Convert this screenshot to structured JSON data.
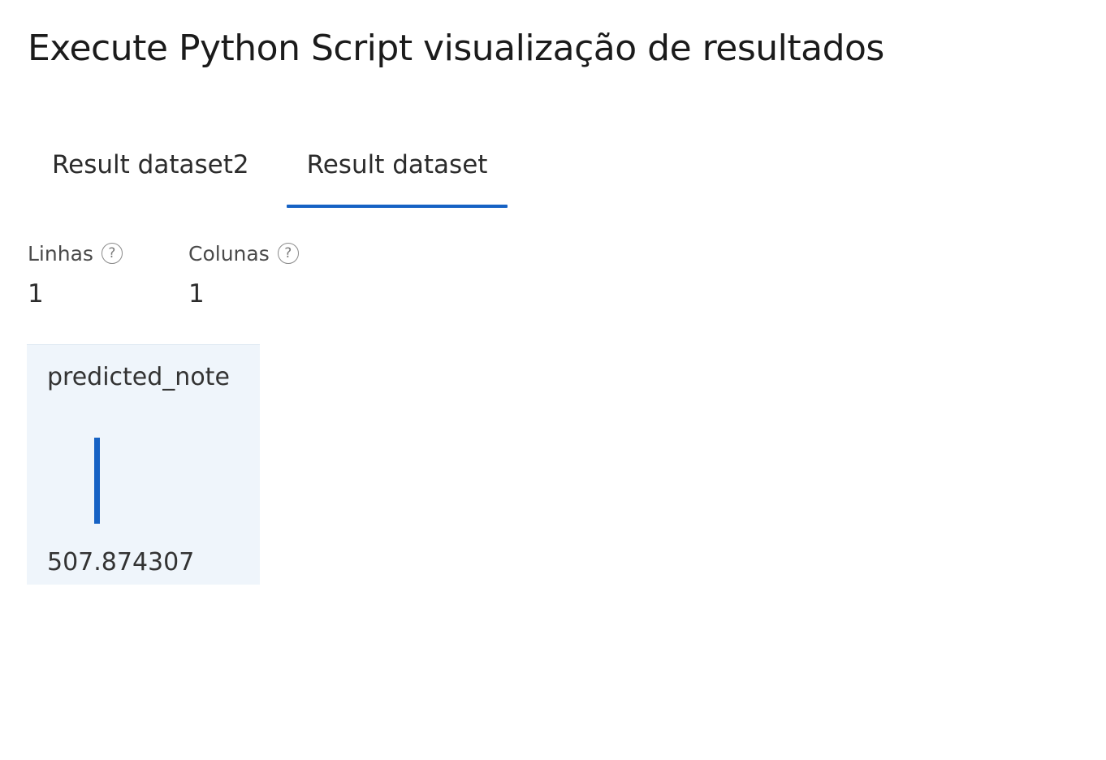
{
  "header": {
    "title": "Execute Python Script visualização de resultados"
  },
  "tabs": [
    {
      "label": "Result dataset2",
      "active": false
    },
    {
      "label": "Result dataset",
      "active": true
    }
  ],
  "stats": {
    "rows": {
      "label": "Linhas",
      "value": "1",
      "help_icon": "question-circle-icon"
    },
    "columns": {
      "label": "Colunas",
      "value": "1",
      "help_icon": "question-circle-icon"
    }
  },
  "columns": [
    {
      "name": "predicted_note",
      "value": "507.874307",
      "histogram": {
        "bins": [
          1
        ],
        "color": "#1662c4"
      }
    }
  ],
  "colors": {
    "accent": "#1662c4",
    "card_background": "#eff5fb"
  }
}
